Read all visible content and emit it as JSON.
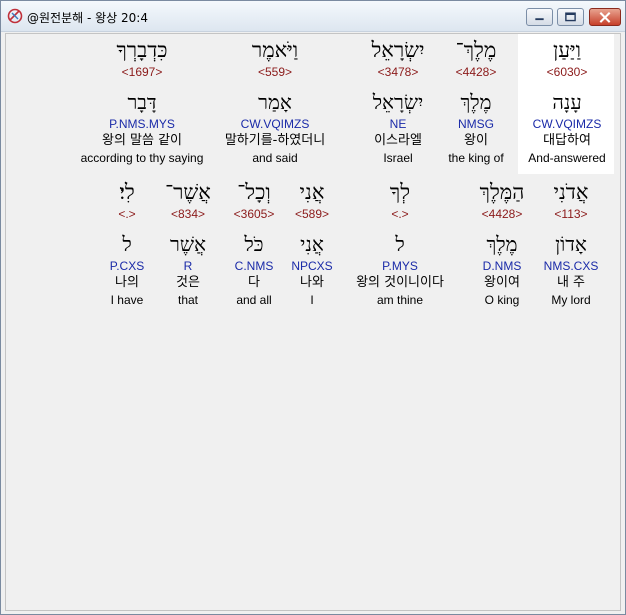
{
  "window": {
    "title": "@원전분해 - 왕상 20:4",
    "minimize_label": "minimize",
    "maximize_label": "maximize",
    "close_label": "close"
  },
  "row1": [
    {
      "hebrew": "וַיַּעַן",
      "strong": "<6030>",
      "lemma": "עָנָה",
      "parse": "CW.VQIMZS",
      "korean": "대답하여",
      "english": "And-answered"
    },
    {
      "hebrew": "מֶלֶךְ־",
      "strong": "<4428>",
      "lemma": "מֶלֶךְ",
      "parse": "NMSG",
      "korean": "왕이",
      "english": "the king of"
    },
    {
      "hebrew": "יִשְׂרָאֵל",
      "strong": "<3478>",
      "lemma": "יִשְׂרָאֵל",
      "parse": "NE",
      "korean": "이스라엘",
      "english": "Israel"
    },
    {
      "hebrew": "וַיֹּאמֶר",
      "strong": "<559>",
      "lemma": "אָמַר",
      "parse": "CW.VQIMZS",
      "korean": "말하기를-하였더니",
      "english": "and said"
    },
    {
      "hebrew": "כִּדְבָרְךָ",
      "strong": "<1697>",
      "lemma": "דָּבָר",
      "parse": "P.NMS.MYS",
      "korean": "왕의 말씀 같이",
      "english": "according to thy saying"
    }
  ],
  "row2": [
    {
      "hebrew": "אֲדֹנִי",
      "strong": "<113>",
      "lemma": "אָדוֹן",
      "parse": "NMS.CXS",
      "korean": "내 주",
      "english": "My lord"
    },
    {
      "hebrew": "הַמֶּלֶךְ",
      "strong": "<4428>",
      "lemma": "מֶלֶךְ",
      "parse": "D.NMS",
      "korean": "왕이여",
      "english": "O king"
    },
    {
      "hebrew": "לְךָ",
      "strong": "<.>",
      "lemma": "ל",
      "parse": "P.MYS",
      "korean": "왕의 것이니이다",
      "english": "am thine"
    },
    {
      "hebrew": "אֲנִי",
      "strong": "<589>",
      "lemma": "אֲנִי",
      "parse": "NPCXS",
      "korean": "나와",
      "english": "I"
    },
    {
      "hebrew": "וְכָל־",
      "strong": "<3605>",
      "lemma": "כֹּל",
      "parse": "C.NMS",
      "korean": "다",
      "english": "and all"
    },
    {
      "hebrew": "אֲשֶׁר־",
      "strong": "<834>",
      "lemma": "אֲשֶׁר",
      "parse": "R",
      "korean": "것은",
      "english": "that"
    },
    {
      "hebrew": "לִי׃",
      "strong": "<.>",
      "lemma": "ל",
      "parse": "P.CXS",
      "korean": "나의",
      "english": "I have"
    }
  ]
}
